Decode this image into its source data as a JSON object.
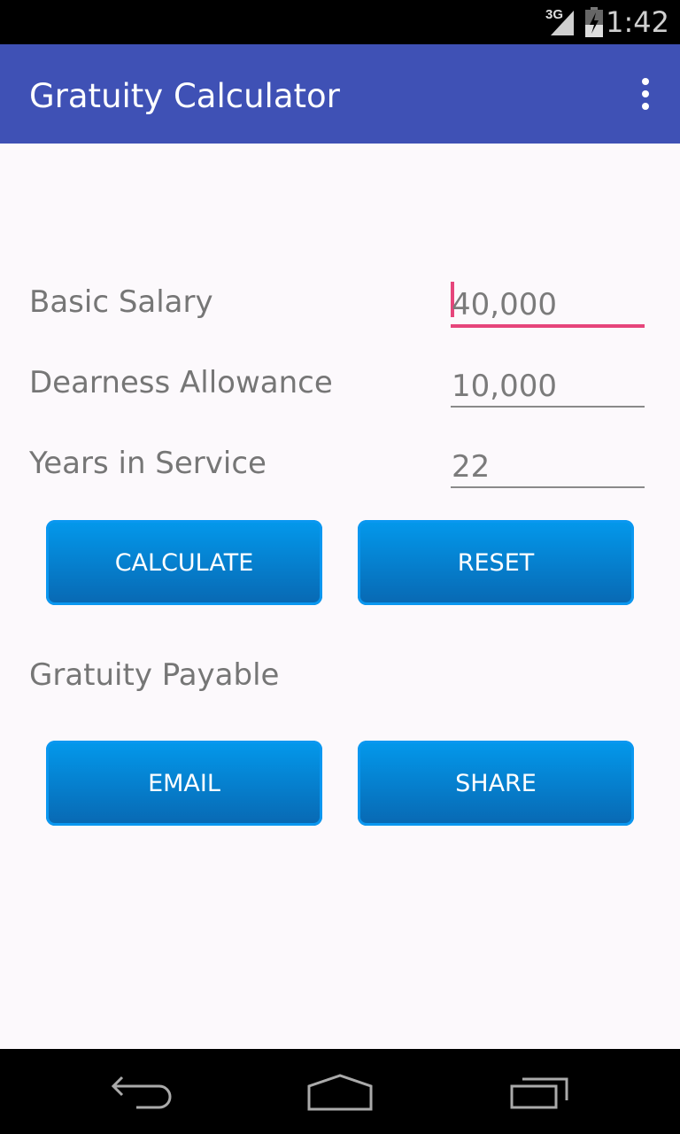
{
  "status_bar": {
    "network": "3G",
    "time": "1:42"
  },
  "app_bar": {
    "title": "Gratuity Calculator",
    "menu_icon": "overflow-menu-icon"
  },
  "form": {
    "fields": [
      {
        "label": "Basic Salary",
        "value": "40,000",
        "focused": true
      },
      {
        "label": "Dearness Allowance",
        "value": "10,000",
        "focused": false
      },
      {
        "label": "Years in Service",
        "value": "22",
        "focused": false
      }
    ]
  },
  "buttons": {
    "calculate": "CALCULATE",
    "reset": "RESET",
    "email": "EMAIL",
    "share": "SHARE"
  },
  "result": {
    "label": "Gratuity Payable"
  },
  "colors": {
    "app_bar": "#3f51b5",
    "accent": "#e6457b",
    "button": "#0399ec"
  },
  "nav_bar": {
    "icons": [
      "back-icon",
      "home-icon",
      "recents-icon"
    ]
  }
}
